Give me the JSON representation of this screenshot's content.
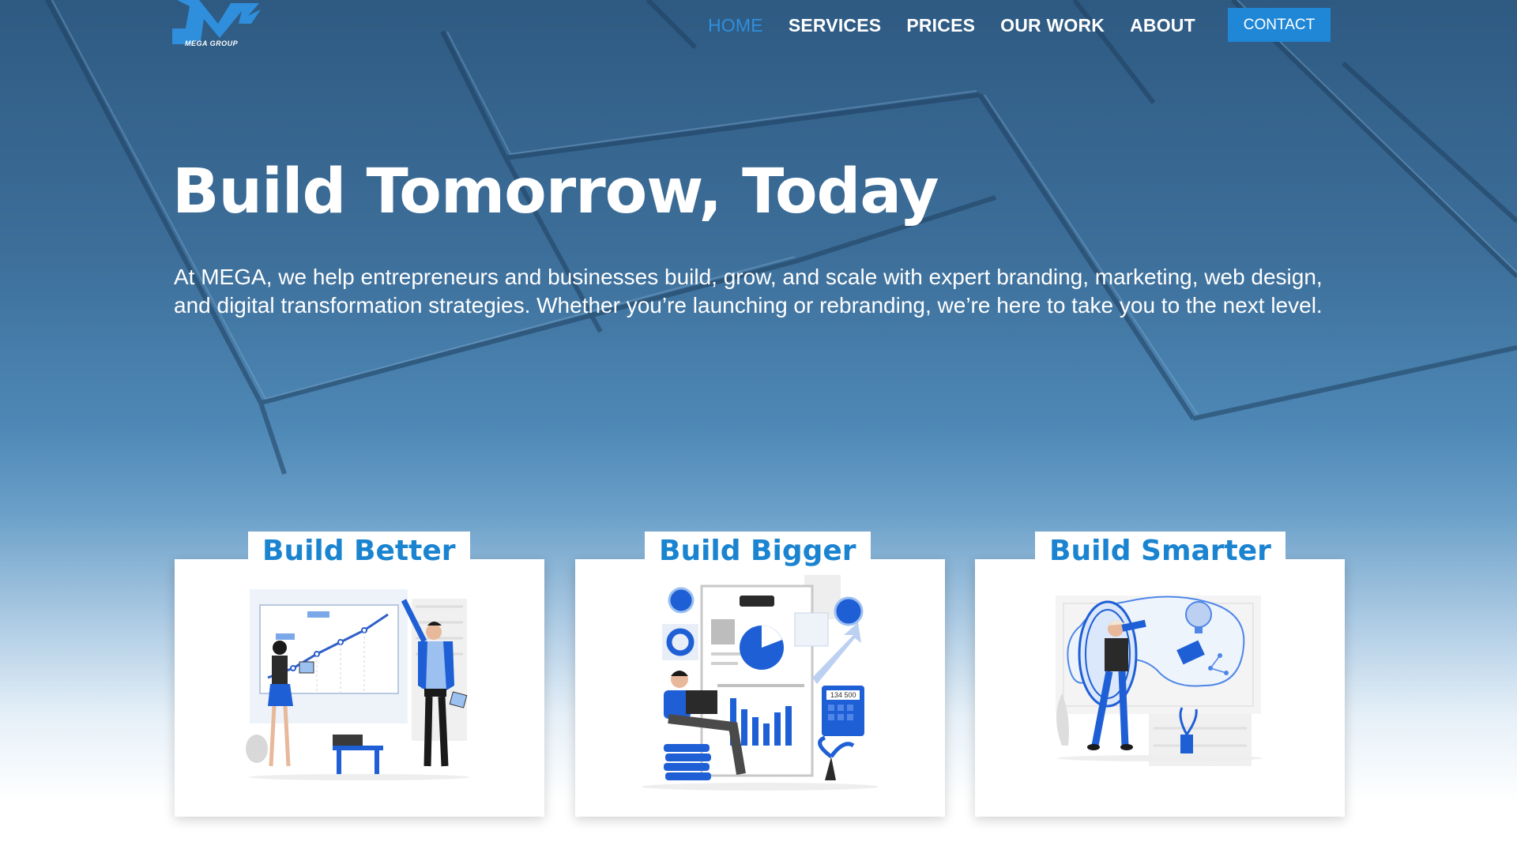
{
  "brand": {
    "logo_text": "MEGA GROUP",
    "accent_color": "#1f87d6",
    "active_color": "#2f8fdc"
  },
  "nav": {
    "items": [
      {
        "label": "HOME",
        "active": true
      },
      {
        "label": "SERVICES",
        "active": false
      },
      {
        "label": "PRICES",
        "active": false
      },
      {
        "label": "OUR WORK",
        "active": false
      },
      {
        "label": "ABOUT",
        "active": false
      }
    ],
    "contact_label": "CONTACT"
  },
  "hero": {
    "title": "Build Tomorrow, Today",
    "description": "At MEGA, we help entrepreneurs and businesses build, grow, and scale with expert branding, marketing, web design, and digital transformation strategies. Whether you’re launching or rebranding, we’re here to take you to the next level."
  },
  "cards": [
    {
      "title": "Build Better",
      "illustration": "team-presentation-illustration"
    },
    {
      "title": "Build Bigger",
      "illustration": "growth-analytics-illustration"
    },
    {
      "title": "Build Smarter",
      "illustration": "vision-ideas-illustration"
    }
  ],
  "illustration_texts": {
    "calculator_display": "134 500"
  }
}
